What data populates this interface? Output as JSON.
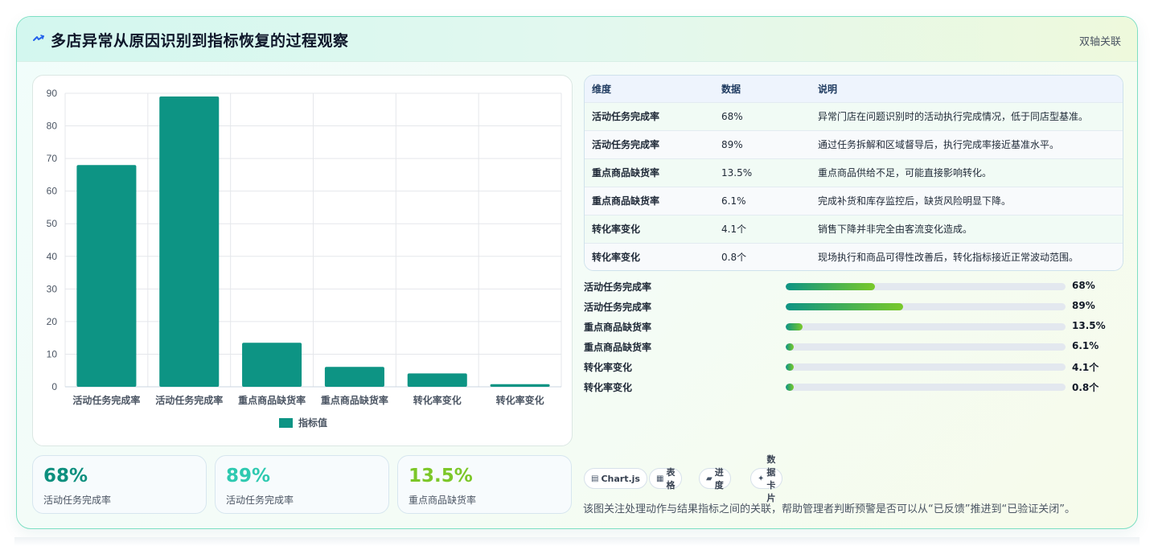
{
  "header": {
    "title": "多店异常从原因识别到指标恢复的过程观察",
    "tag": "双轴关联",
    "icon": "lightning-icon"
  },
  "chart_data": {
    "type": "bar",
    "categories": [
      "活动任务完成率",
      "活动任务完成率",
      "重点商品缺货率",
      "重点商品缺货率",
      "转化率变化",
      "转化率变化"
    ],
    "series": [
      {
        "name": "指标值",
        "values": [
          68,
          89,
          13.5,
          6.1,
          4.1,
          0.8
        ]
      }
    ],
    "ylim": [
      0,
      90
    ],
    "yticks": [
      0,
      10,
      20,
      30,
      40,
      50,
      60,
      70,
      80,
      90
    ],
    "grid": true,
    "legend": "bottom",
    "bar_color": "#0d9484"
  },
  "table": {
    "headers": [
      "维度",
      "数据",
      "说明"
    ],
    "rows": [
      [
        "活动任务完成率",
        "68%",
        "异常门店在问题识别时的活动执行完成情况，低于同店型基准。"
      ],
      [
        "活动任务完成率",
        "89%",
        "通过任务拆解和区域督导后，执行完成率接近基准水平。"
      ],
      [
        "重点商品缺货率",
        "13.5%",
        "重点商品供给不足，可能直接影响转化。"
      ],
      [
        "重点商品缺货率",
        "6.1%",
        "完成补货和库存监控后，缺货风险明显下降。"
      ],
      [
        "转化率变化",
        "4.1个",
        "销售下降并非完全由客流变化造成。"
      ],
      [
        "转化率变化",
        "0.8个",
        "现场执行和商品可得性改善后，转化指标接近正常波动范围。"
      ]
    ]
  },
  "progress": [
    {
      "label": "活动任务完成率",
      "value": "68%",
      "fill": 0.32
    },
    {
      "label": "活动任务完成率",
      "value": "89%",
      "fill": 0.42
    },
    {
      "label": "重点商品缺货率",
      "value": "13.5%",
      "fill": 0.06
    },
    {
      "label": "重点商品缺货率",
      "value": "6.1%",
      "fill": 0.03
    },
    {
      "label": "转化率变化",
      "value": "4.1个",
      "fill": 0.03
    },
    {
      "label": "转化率变化",
      "value": "0.8个",
      "fill": 0.03
    }
  ],
  "kpis": [
    {
      "value": "68%",
      "label": "活动任务完成率",
      "color": "#0d8f7e"
    },
    {
      "value": "89%",
      "label": "活动任务完成率",
      "color": "#2ec9b0"
    },
    {
      "value": "13.5%",
      "label": "重点商品缺货率",
      "color": "#7cc728"
    }
  ],
  "pills": [
    {
      "icon": "chart-js-icon",
      "glyph": "▤",
      "label": "Chart.js"
    },
    {
      "icon": "table-icon",
      "glyph": "▦",
      "label": "表格"
    },
    {
      "icon": "progress-icon",
      "glyph": "▰",
      "label": "进度"
    },
    {
      "icon": "sparkle-icon",
      "glyph": "✦",
      "label": "数据卡片"
    }
  ],
  "footnote": "该图关注处理动作与结果指标之间的关联，帮助管理者判断预警是否可以从“已反馈”推进到“已验证关闭”。"
}
